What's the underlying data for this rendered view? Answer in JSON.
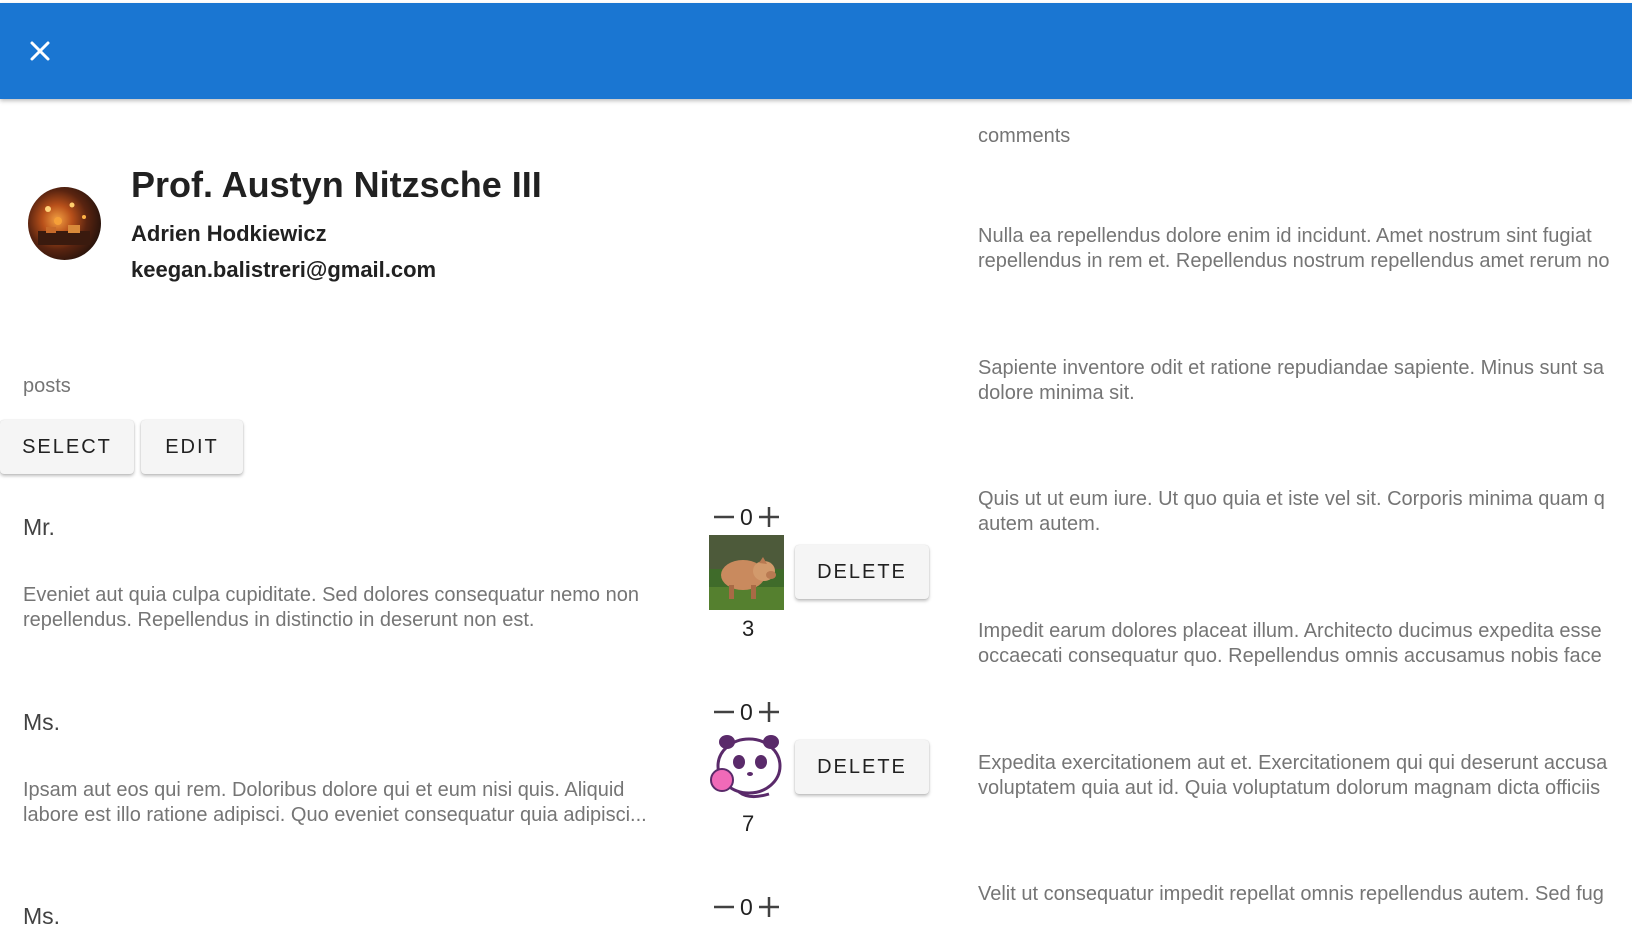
{
  "appbar": {
    "close_icon": "close-icon",
    "color": "#1a76d2"
  },
  "profile": {
    "name": "Prof. Austyn Nitzsche III",
    "username": "Adrien Hodkiewicz",
    "email": "keegan.balistreri@gmail.com"
  },
  "posts": {
    "label": "posts",
    "select_label": "SELECT",
    "edit_label": "EDIT",
    "items": [
      {
        "title": "Mr.",
        "body": "Eveniet aut quia culpa cupiditate. Sed dolores consequatur nemo non repellendus. Repellendus in distinctio in deserunt non est.",
        "score": "0",
        "count": "3",
        "delete_label": "DELETE"
      },
      {
        "title": "Ms.",
        "body": "Ipsam aut eos qui rem. Doloribus dolore qui et eum nisi quis. Aliquid labore est illo ratione adipisci. Quo eveniet consequatur quia adipisci...",
        "score": "0",
        "count": "7",
        "delete_label": "DELETE"
      },
      {
        "title": "Ms.",
        "score": "0"
      }
    ]
  },
  "comments": {
    "label": "comments",
    "items": [
      {
        "line1": "Nulla ea repellendus dolore enim id incidunt. Amet nostrum sint fugiat",
        "line2": "repellendus in rem et. Repellendus nostrum repellendus amet rerum no"
      },
      {
        "line1": "Sapiente inventore odit et ratione repudiandae sapiente. Minus sunt sa",
        "line2": "dolore minima sit."
      },
      {
        "line1": "Quis ut ut eum iure. Ut quo quia et iste vel sit. Corporis minima quam q",
        "line2": "autem autem."
      },
      {
        "line1": "Impedit earum dolores placeat illum. Architecto ducimus expedita esse",
        "line2": "occaecati consequatur quo. Repellendus omnis accusamus nobis face"
      },
      {
        "line1": "Expedita exercitationem aut et. Exercitationem qui qui deserunt accusa",
        "line2": "voluptatem quia aut id. Quia voluptatum dolorum magnam dicta officiis"
      },
      {
        "line1": "Velit ut consequatur impedit repellat omnis repellendus autem. Sed fug",
        "line2": ""
      }
    ]
  }
}
